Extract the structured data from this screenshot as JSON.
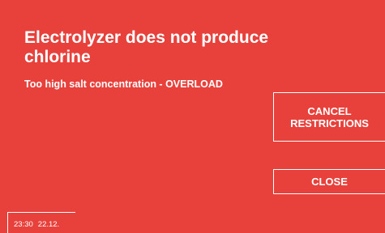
{
  "dialog": {
    "title": "Electrolyzer does not produce chlorine",
    "message": "Too high salt concentration - OVERLOAD",
    "background": "#e8413c"
  },
  "buttons": {
    "cancel_restrictions_label": "CANCEL\nRESTRICTIONS",
    "close_label": "CLOSE"
  },
  "status": {
    "time": "23:30",
    "date": "22.12."
  }
}
